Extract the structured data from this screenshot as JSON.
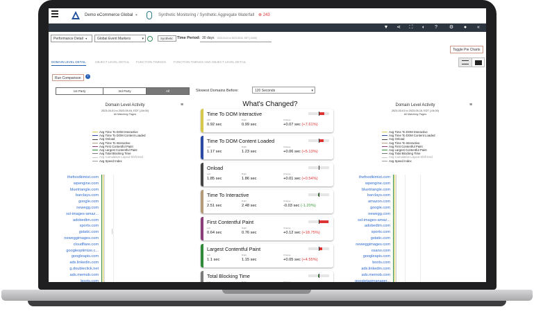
{
  "app": {
    "menu_label": "MENU",
    "org_name": "Demo eCommerce Global",
    "breadcrumb": "Synthetic Monitoring / Synthetic Aggregate Waterfall",
    "alert_count": "243"
  },
  "toolbar": {
    "icons": [
      "filter-icon",
      "share-icon",
      "fullscreen-icon",
      "contrast-icon",
      "help-icon",
      "settings-icon",
      "user-icon",
      "collapse-icon"
    ]
  },
  "controls": {
    "performance_detail": "Performance Detail",
    "event_markers": "Global Event Markers",
    "synthetic_tag": "Synthetic",
    "time_period_label": "Time Period:",
    "time_period_value": "30 days",
    "time_period_range": "2023-04-01 to 2023-05-04, EDT (-04:00)",
    "toggle_pie_charts": "Toggle Pie Charts",
    "run_comparison": "Run Comparison"
  },
  "tabs": [
    {
      "label": "DOMAIN LEVEL DETAIL",
      "active": true
    },
    {
      "label": "OBJECT LEVEL DETAIL",
      "active": false
    },
    {
      "label": "FUNCTION TIMINGS",
      "active": false
    },
    {
      "label": "FUNCTION TIMINGS AND OBJECT LEVEL DETAIL",
      "active": false
    }
  ],
  "party_filter": [
    "1st Party",
    "3rd Party",
    "All"
  ],
  "slowest": {
    "label": "Slowest Domains Before:",
    "value": "120 Seconds"
  },
  "left_panel": {
    "title": "Domain Level Activity",
    "date_range": "2023-04-01 to 2023-05-04, EDT (-04:00)",
    "pages": "All Matching Pages",
    "legend": [
      {
        "label": "Avg Time To DOM Interactive",
        "color": "#d6c84a"
      },
      {
        "label": "Avg Time To DOM Content Loaded",
        "color": "#2a4aa6"
      },
      {
        "label": "Avg Onload",
        "color": "#444444"
      },
      {
        "label": "Avg Time To Interactive",
        "color": "#b59a79"
      },
      {
        "label": "Avg First Contentful Paint",
        "color": "#8b3d7a"
      },
      {
        "label": "Avg Largest Contentful Paint",
        "color": "#2f8a3a"
      },
      {
        "label": "Avg Total Blocking Time",
        "color": "#7a7a7a"
      },
      {
        "label": "Avg Cumulative Layout Shift End",
        "color": "#c8c8c8"
      },
      {
        "label": "Avg Speed Index",
        "color": "#9a9a9a"
      }
    ],
    "domains": [
      "thefoodkimist.com",
      "wpengine.com",
      "bluetriangle.com",
      "barclays.com",
      "google.com",
      "newegg.com",
      "ssl-images-amaz...",
      "adobedtm.com",
      "sports.com",
      "gstatic.com",
      "neweggimages.com",
      "cloudflare.com",
      "googleoptimize.c...",
      "googleapis.com",
      "ads.linkedin.com",
      "g.doubleclick.net",
      "ads.memob.com",
      "boots.com"
    ]
  },
  "right_panel": {
    "title": "Domain Level Activity",
    "date_range": "2023-03-01 to 2023-05-15, EDT (-04:00)",
    "pages": "All Matching Pages",
    "legend": [
      {
        "label": "Avg Time To DOM Interactive",
        "color": "#d6c84a"
      },
      {
        "label": "Avg Time To DOM Content Loaded",
        "color": "#2a4aa6"
      },
      {
        "label": "Avg Onload",
        "color": "#444444"
      },
      {
        "label": "Avg Time To Interactive",
        "color": "#b59a79"
      },
      {
        "label": "Avg First Contentful Paint",
        "color": "#8b3d7a"
      },
      {
        "label": "Avg Largest Contentful Paint",
        "color": "#2f8a3a"
      },
      {
        "label": "Avg Total Blocking Time",
        "color": "#7a7a7a"
      },
      {
        "label": "Avg Cumulative Layout Shift End",
        "color": "#c8c8c8"
      },
      {
        "label": "Avg Speed Index",
        "color": "#9a9a9a"
      }
    ],
    "domains": [
      "thefoodkimist.com",
      "wpengine.com",
      "bluetriangle.com",
      "barclays.com",
      "amazon.com",
      "google.com",
      "newegg.com",
      "ssl-images-amaz...",
      "adobedtm.com",
      "sports.com",
      "gstatic.com",
      "neweggimages.com",
      "osano.com",
      "googleapis.com",
      "boots.com",
      "ads.linkedin.com",
      "ads.memob.com",
      "googletagmanager...",
      "www.boots.com",
      "www.google.co.uk"
    ]
  },
  "whats_changed": {
    "title": "What's Changed?",
    "col_left": "Left",
    "col_right": "Right",
    "col_change": "Change",
    "metrics": [
      {
        "name": "Time To DOM Interactive",
        "color": "#d6c84a",
        "left": "0.92 sec",
        "right": "0.99 sec",
        "change": "+0.07 sec (+7.61%)",
        "dir": "up",
        "bar": 0.5
      },
      {
        "name": "Time To DOM Content Loaded",
        "color": "#2a4aa6",
        "left": "1.17 sec",
        "right": "1.23 sec",
        "change": "+0.06 sec (+5.13%)",
        "dir": "up",
        "bar": 0.45
      },
      {
        "name": "Onload",
        "color": "#444444",
        "left": "1.85 sec",
        "right": "1.86 sec",
        "change": "+0.01 sec (+0.54%)",
        "dir": "up",
        "bar": 0.05
      },
      {
        "name": "Time To Interactive",
        "color": "#b59a79",
        "left": "2.51 sec",
        "right": "2.48 sec",
        "change": "-0.03 sec (-1.20%)",
        "dir": "dn",
        "bar": 0.1
      },
      {
        "name": "First Contentful Paint",
        "color": "#8b3d7a",
        "left": "0.64 sec",
        "right": "0.76 sec",
        "change": "+0.12 sec (+18.75%)",
        "dir": "up",
        "bar": 0.9
      },
      {
        "name": "Largest Contentful Paint",
        "color": "#2f8a3a",
        "left": "1.1 sec",
        "right": "1.15 sec",
        "change": "+0.05 sec (+4.55%)",
        "dir": "up",
        "bar": 0.35
      },
      {
        "name": "Total Blocking Time",
        "color": "#7a7a7a",
        "left": "",
        "right": "",
        "change": "",
        "dir": "dn",
        "bar": 0.1
      }
    ]
  }
}
